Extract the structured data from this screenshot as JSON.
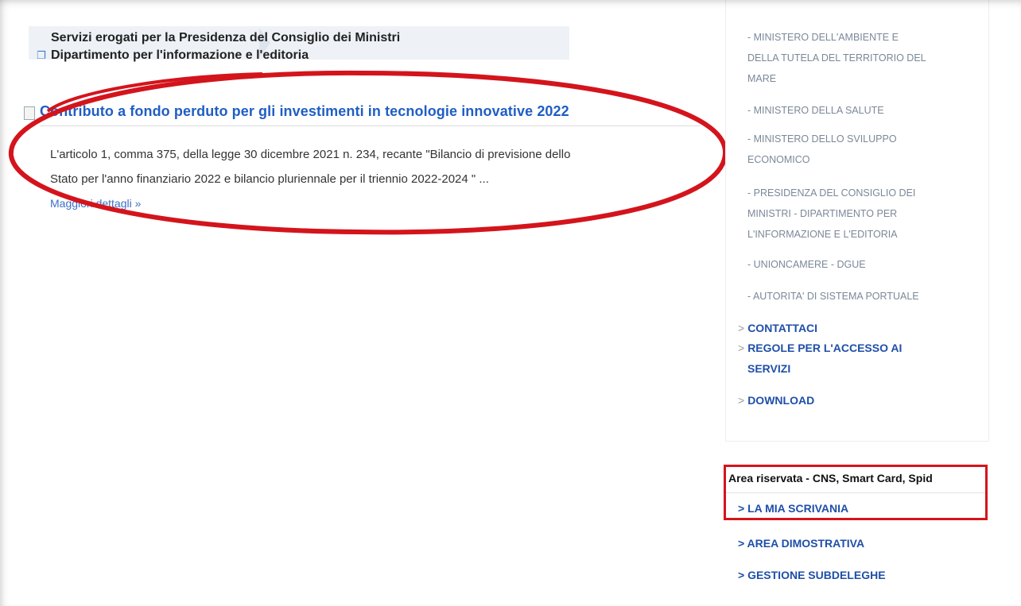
{
  "service": {
    "line1": "Servizi erogati per la Presidenza del Consiglio dei Ministri",
    "line2": "Dipartimento per l'informazione e l'editoria"
  },
  "article": {
    "title": "Contributo a fondo perduto per gli investimenti in tecnologie innovative 2022",
    "body_line1": "L'articolo 1, comma 375, della legge 30 dicembre 2021 n. 234, recante \"Bilancio di previsione dello",
    "body_line2": "Stato per l'anno finanziario 2022 e bilancio pluriennale per il triennio 2022-2024 \" ...",
    "more_link": "Maggiori dettagli »"
  },
  "sidebar": {
    "ministries": [
      {
        "line1": "- MINISTERO DELL'AMBIENTE E",
        "line2": "DELLA TUTELA DEL TERRITORIO DEL",
        "line3": "MARE"
      },
      {
        "line1": "- MINISTERO DELLA SALUTE"
      },
      {
        "line1": "- MINISTERO DELLO SVILUPPO",
        "line2": "ECONOMICO"
      },
      {
        "line1": "- PRESIDENZA DEL CONSIGLIO DEI",
        "line2": "MINISTRI - DIPARTIMENTO PER",
        "line3": "L'INFORMAZIONE E L'EDITORIA"
      },
      {
        "line1": "- UNIONCAMERE - DGUE"
      },
      {
        "line1": "- AUTORITA' DI SISTEMA PORTUALE"
      }
    ],
    "links": {
      "contact": "CONTATTACI",
      "rules_line1": "REGOLE PER L'ACCESSO AI",
      "rules_line2": "SERVIZI",
      "download": "DOWNLOAD"
    },
    "gt": ">"
  },
  "reserved_area": {
    "title": "Area riservata - CNS, Smart Card, Spid",
    "desk": "> LA MIA SCRIVANIA",
    "demo": "> AREA DIMOSTRATIVA",
    "subdelegations": "> GESTIONE SUBDELEGHE"
  },
  "colors": {
    "link": "#1f5ec4",
    "nav_link": "#1f4fa8",
    "annotation_red": "#d4141c"
  }
}
